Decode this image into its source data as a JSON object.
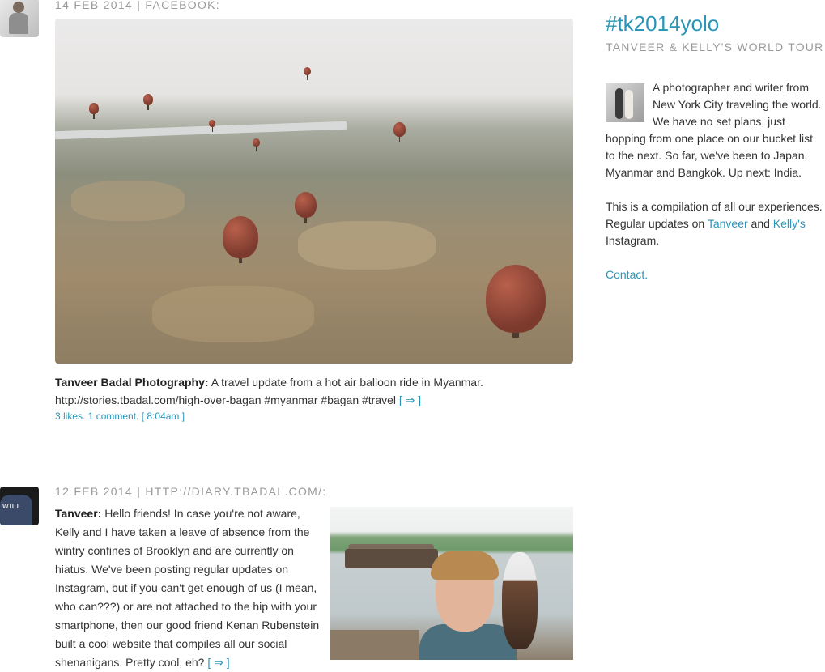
{
  "posts": [
    {
      "date": "14 FEB 2014",
      "source": "FACEBOOK:",
      "author": "Tanveer Badal Photography:",
      "text": "A travel update from a hot air balloon ride in Myanmar.",
      "url_line": "http://stories.tbadal.com/high-over-bagan #myanmar #bagan #travel",
      "more_link": "[ ⇒ ]",
      "stats": "3 likes. 1 comment.",
      "time": "[ 8:04am ]"
    },
    {
      "date": "12 FEB 2014",
      "source": "HTTP://DIARY.TBADAL.COM/:",
      "author": "Tanveer:",
      "text": "Hello friends! In case you're not aware, Kelly and I have taken a leave of absence from the wintry confines of Brooklyn and are currently on hiatus.  We've been posting regular updates on Instagram, but if you can't get enough of us (I mean, who can???) or are not attached to the hip with your smartphone, then our good friend Kenan Rubenstein built a cool website that compiles all our social shenanigans.  Pretty cool, eh?",
      "more_link": "[ ⇒ ]"
    }
  ],
  "sidebar": {
    "title": "#tk2014yolo",
    "subtitle": "TANVEER & KELLY'S WORLD TOUR",
    "bio": "A photographer and writer from New York City traveling the world. We have no set plans, just hopping from one place on our bucket list to the next. So far, we've been to Japan, Myanmar and Bangkok. Up next: India.",
    "compilation_prefix": "This is a compilation of all our experiences. Regular updates on ",
    "link_tanveer": "Tanveer",
    "and_word": " and ",
    "link_kelly": "Kelly's",
    "compilation_suffix": " Instagram.",
    "contact": "Contact."
  },
  "icons": {
    "avatar_1": "tanveer-avatar",
    "avatar_2": "tanveer-shirt-avatar",
    "bio_thumb": "couple-photo"
  },
  "colors": {
    "accent": "#2a95b7",
    "meta": "#9a9a9a",
    "text": "#333333"
  }
}
